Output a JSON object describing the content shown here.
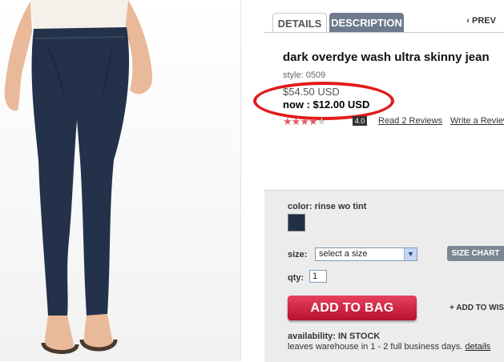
{
  "tabs": {
    "details": "DETAILS",
    "description": "DESCRIPTION"
  },
  "nav": {
    "prev": "PREV"
  },
  "product": {
    "title": "dark overdye wash ultra skinny jean",
    "style": "style: 0509",
    "old_price": "$54.50 USD",
    "now_price": "now : $12.00 USD",
    "rating": {
      "stars": 4,
      "max": 5,
      "value": "4.0"
    },
    "read_reviews": "Read 2 Reviews",
    "write_review": "Write a Review"
  },
  "options": {
    "color_label": "color: rinse wo tint",
    "swatch_color": "#213047",
    "size_label": "size:",
    "size_value": "select a size",
    "size_chart": "SIZE CHART",
    "qty_label": "qty:",
    "qty_value": "1",
    "add_to_bag": "ADD TO BAG",
    "add_to_wishlist": "ADD TO WISHLIST"
  },
  "availability": {
    "label": "availability: IN STOCK",
    "leaves": "leaves warehouse in 1 - 2 full business days.",
    "details_link": "details"
  },
  "colors": {
    "accent_red": "#e11b1b",
    "button_red": "#c8193a",
    "tab_active_bg": "#6d7b8d"
  }
}
